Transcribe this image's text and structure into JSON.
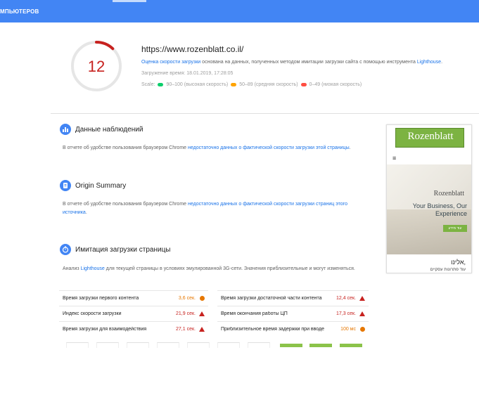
{
  "topbar": {
    "tab_label": "МПЬЮТЕРОВ"
  },
  "score": {
    "value": "12",
    "fraction": 0.12,
    "color": "#c7221f"
  },
  "header": {
    "url": "https://www.rozenblatt.co.il/",
    "desc_link": "Оценка скорости загрузки",
    "desc_text": " основана на данных, полученных методом имитации загрузки сайта с помощью инструмента ",
    "desc_tool": "Lighthouse",
    "desc_end": ".",
    "load_time": "Загружение время: 18.01.2019, 17:28:05",
    "scale_label": "Scale:",
    "scale_fast": "90–100 (высокая скорость)",
    "scale_mid": "50–89 (средняя скорость)",
    "scale_slow": "0–49 (низкая скорость)"
  },
  "colors": {
    "fast": "#0cce6b",
    "mid": "#ffa400",
    "slow": "#ff4e42",
    "accent": "#4285f4"
  },
  "sections": {
    "field": {
      "title": "Данные наблюдений",
      "text_prefix": "В отчете об удобстве пользования браузером Chrome ",
      "text_link": "недостаточно данных о фактической скорости загрузки этой страницы",
      "text_suffix": "."
    },
    "origin": {
      "title": "Origin Summary",
      "text_prefix": "В отчете об удобстве пользования браузером Chrome ",
      "text_link": "недостаточно данных о фактической скорости загрузки страниц этого источника",
      "text_suffix": "."
    },
    "lab": {
      "title": "Имитация загрузки страницы",
      "text_prefix": "Анализ ",
      "text_link": "Lighthouse",
      "text_suffix": " для текущей страницы в условиях эмулированной 3G-сети. Значения приблизительные и могут изменяться."
    }
  },
  "metrics": {
    "left": [
      {
        "label": "Время загрузки первого контента",
        "value": "3,6 сек.",
        "status": "average"
      },
      {
        "label": "Индекс скорости загрузки",
        "value": "21,9 сек.",
        "status": "slow"
      },
      {
        "label": "Время загрузки для взаимодействия",
        "value": "27,1 сек.",
        "status": "slow"
      }
    ],
    "right": [
      {
        "label": "Время загрузки достаточной части контента",
        "value": "12,4 сек.",
        "status": "slow"
      },
      {
        "label": "Время окончания работы ЦП",
        "value": "17,3 сек.",
        "status": "slow"
      },
      {
        "label": "Приблизительное время задержки при вводе",
        "value": "100 мс",
        "status": "average"
      }
    ]
  },
  "preview": {
    "logo": "Rozenblatt",
    "menu_icon": "≡",
    "brand": "Rozenblatt",
    "tagline": "Your Business, Our Experience",
    "button": "עוד מידע",
    "hebrew_title": "אלינו,",
    "hebrew_sub": "עוד פתרונות עסקיים"
  }
}
